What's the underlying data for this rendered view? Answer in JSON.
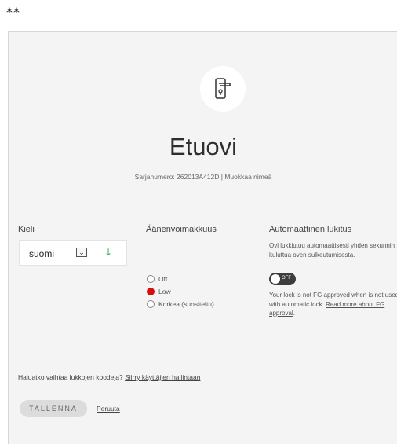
{
  "header": {
    "stars": "**"
  },
  "lock": {
    "icon": "door-handle-icon",
    "name": "Etuovi",
    "serial_text": "Sarjanumero: 262013A412D | ",
    "rename_label": "Muokkaa nimeä"
  },
  "language": {
    "label": "Kieli",
    "selected": "suomi"
  },
  "volume": {
    "label": "Äänenvoimakkuus",
    "options": [
      {
        "label": "Off",
        "checked": false
      },
      {
        "label": "Low",
        "checked": true
      },
      {
        "label": "Korkea (suositeltu)",
        "checked": false
      }
    ],
    "accent": "#d20f0f"
  },
  "autolock": {
    "label": "Automaattinen lukitus",
    "description": "Ovi lukkiutuu automaattisesti yhden sekunnin kuluttua oven sulkeutumisesta.",
    "toggle_text": "OFF",
    "fg_note": "Your lock is not FG approved when is not used with automatic lock.",
    "fg_link": "Read more about FG approval",
    "fg_link_suffix": "."
  },
  "codes": {
    "prompt": "Haluatko vaihtaa lukkojen koodeja? ",
    "link": "Siirry käyttäjien hallintaan"
  },
  "actions": {
    "save_label": "TALLENNA",
    "cancel_label": "Peruuta"
  }
}
